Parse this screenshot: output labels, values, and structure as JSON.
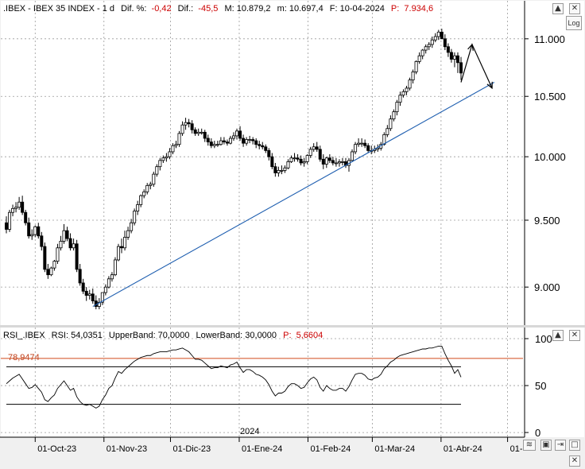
{
  "header": {
    "symbol": ".IBEX - IBEX 35 INDEX - 1 d",
    "dif_pct_label": "Dif. %:",
    "dif_pct_value": "-0,42",
    "dif_label": "Dif.:",
    "dif_value": "-45,5",
    "max_label": "M: 10.879,2",
    "min_label": "m: 10.697,4",
    "date_label": "F: 10-04-2024",
    "p_label": "P:",
    "p_value": "7.934,6"
  },
  "rsi_header": {
    "title": "RSI_.IBEX",
    "rsi_label": "RSI: 54,0351",
    "upper_label": "UpperBand: 70,0000",
    "lower_label": "LowerBand: 30,0000",
    "p_label": "P:",
    "p_value": "5,6604",
    "level_label": "78,9474"
  },
  "buttons": {
    "log": "Log",
    "up": "▲",
    "close": "✕",
    "down": "▼"
  },
  "colors": {
    "up": "#ffffff",
    "down": "#000000",
    "trend": "#1f5fb0",
    "level": "#d04a1a",
    "neg": "#cc0000"
  },
  "chart_data": [
    {
      "type": "candlestick",
      "title": ".IBEX - IBEX 35 INDEX - 1 d",
      "x": [
        "2023-09-18",
        "2023-09-19",
        "2023-09-20",
        "2023-09-21",
        "2023-09-22",
        "2023-09-25",
        "2023-09-26",
        "2023-09-27",
        "2023-09-28",
        "2023-09-29",
        "2023-10-02",
        "2023-10-03",
        "2023-10-04",
        "2023-10-05",
        "2023-10-06",
        "2023-10-09",
        "2023-10-10",
        "2023-10-11",
        "2023-10-12",
        "2023-10-13",
        "2023-10-16",
        "2023-10-17",
        "2023-10-18",
        "2023-10-19",
        "2023-10-20",
        "2023-10-23",
        "2023-10-24",
        "2023-10-25",
        "2023-10-26",
        "2023-10-27",
        "2023-10-30",
        "2023-10-31",
        "2023-11-01",
        "2023-11-02",
        "2023-11-03",
        "2023-11-06",
        "2023-11-07",
        "2023-11-08",
        "2023-11-09",
        "2023-11-10",
        "2023-11-13",
        "2023-11-14",
        "2023-11-15",
        "2023-11-16",
        "2023-11-17",
        "2023-11-20",
        "2023-11-21",
        "2023-11-22",
        "2023-11-23",
        "2023-11-24",
        "2023-11-27",
        "2023-11-28",
        "2023-11-29",
        "2023-11-30",
        "2023-12-01",
        "2023-12-04",
        "2023-12-05",
        "2023-12-06",
        "2023-12-07",
        "2023-12-08",
        "2023-12-11",
        "2023-12-12",
        "2023-12-13",
        "2023-12-14",
        "2023-12-15",
        "2023-12-18",
        "2023-12-19",
        "2023-12-20",
        "2023-12-21",
        "2023-12-22",
        "2023-12-27",
        "2023-12-28",
        "2023-12-29",
        "2024-01-02",
        "2024-01-03",
        "2024-01-04",
        "2024-01-05",
        "2024-01-08",
        "2024-01-09",
        "2024-01-10",
        "2024-01-11",
        "2024-01-12",
        "2024-01-15",
        "2024-01-16",
        "2024-01-17",
        "2024-01-18",
        "2024-01-19",
        "2024-01-22",
        "2024-01-23",
        "2024-01-24",
        "2024-01-25",
        "2024-01-26",
        "2024-01-29",
        "2024-01-30",
        "2024-01-31",
        "2024-02-01",
        "2024-02-02",
        "2024-02-05",
        "2024-02-06",
        "2024-02-07",
        "2024-02-08",
        "2024-02-09",
        "2024-02-12",
        "2024-02-13",
        "2024-02-14",
        "2024-02-15",
        "2024-02-16",
        "2024-02-19",
        "2024-02-20",
        "2024-02-21",
        "2024-02-22",
        "2024-02-23",
        "2024-02-26",
        "2024-02-27",
        "2024-02-28",
        "2024-02-29",
        "2024-03-01",
        "2024-03-04",
        "2024-03-05",
        "2024-03-06",
        "2024-03-07",
        "2024-03-08",
        "2024-03-11",
        "2024-03-12",
        "2024-03-13",
        "2024-03-14",
        "2024-03-15",
        "2024-03-18",
        "2024-03-19",
        "2024-03-20",
        "2024-03-21",
        "2024-03-22",
        "2024-03-25",
        "2024-03-26",
        "2024-03-27",
        "2024-03-28",
        "2024-04-02",
        "2024-04-03",
        "2024-04-04",
        "2024-04-05",
        "2024-04-08",
        "2024-04-09",
        "2024-04-10"
      ],
      "open": [
        9480,
        9430,
        9560,
        9590,
        9600,
        9640,
        9560,
        9480,
        9380,
        9390,
        9450,
        9380,
        9300,
        9130,
        9090,
        9140,
        9190,
        9290,
        9340,
        9420,
        9360,
        9290,
        9320,
        9130,
        9030,
        8970,
        8940,
        8950,
        8900,
        8860,
        8890,
        8960,
        9000,
        9060,
        9090,
        9200,
        9300,
        9290,
        9370,
        9420,
        9480,
        9570,
        9620,
        9690,
        9720,
        9770,
        9780,
        9860,
        9920,
        9970,
        9990,
        10000,
        10040,
        10090,
        10100,
        10190,
        10260,
        10280,
        10270,
        10220,
        10190,
        10200,
        10200,
        10150,
        10120,
        10090,
        10100,
        10100,
        10130,
        10120,
        10110,
        10150,
        10170,
        10210,
        10150,
        10110,
        10140,
        10140,
        10130,
        10100,
        10090,
        10080,
        10050,
        10000,
        9920,
        9870,
        9890,
        9890,
        9910,
        9960,
        9990,
        9990,
        9980,
        9950,
        9960,
        10010,
        10060,
        10080,
        10060,
        9980,
        9940,
        9990,
        9970,
        9950,
        9950,
        9960,
        9960,
        9930,
        9970,
        10040,
        10100,
        10110,
        10110,
        10090,
        10050,
        10050,
        10060,
        10070,
        10100,
        10180,
        10230,
        10310,
        10370,
        10450,
        10510,
        10540,
        10570,
        10640,
        10710,
        10800,
        10850,
        10900,
        10930,
        10950,
        10990,
        11020,
        11060,
        11000,
        10930,
        10880,
        10820,
        10850,
        10790
      ],
      "high": [
        9530,
        9580,
        9620,
        9640,
        9680,
        9690,
        9580,
        9520,
        9430,
        9460,
        9480,
        9410,
        9330,
        9170,
        9150,
        9200,
        9320,
        9380,
        9470,
        9450,
        9400,
        9360,
        9350,
        9170,
        9060,
        9000,
        8980,
        8990,
        8940,
        8920,
        8960,
        9020,
        9080,
        9110,
        9220,
        9320,
        9360,
        9420,
        9450,
        9510,
        9590,
        9650,
        9700,
        9740,
        9790,
        9800,
        9880,
        9940,
        9990,
        10010,
        10030,
        10070,
        10110,
        10130,
        10210,
        10290,
        10320,
        10310,
        10300,
        10240,
        10230,
        10230,
        10220,
        10180,
        10150,
        10130,
        10130,
        10160,
        10160,
        10140,
        10170,
        10200,
        10230,
        10250,
        10180,
        10160,
        10170,
        10160,
        10150,
        10130,
        10120,
        10100,
        10070,
        10030,
        9950,
        9920,
        9930,
        9930,
        9980,
        10010,
        10030,
        10020,
        10010,
        9990,
        10020,
        10080,
        10110,
        10120,
        10090,
        10020,
        10000,
        10020,
        10000,
        9990,
        9980,
        9990,
        9990,
        9990,
        10060,
        10120,
        10150,
        10150,
        10140,
        10110,
        10090,
        10090,
        10100,
        10120,
        10200,
        10260,
        10340,
        10390,
        10470,
        10540,
        10560,
        10590,
        10660,
        10730,
        10810,
        10880,
        10910,
        10950,
        10970,
        11020,
        11050,
        11080,
        11090,
        11040,
        10960,
        10910,
        10880,
        10880,
        10840
      ],
      "low": [
        9400,
        9410,
        9530,
        9560,
        9580,
        9540,
        9460,
        9360,
        9350,
        9370,
        9360,
        9270,
        9110,
        9060,
        9080,
        9120,
        9170,
        9270,
        9320,
        9340,
        9270,
        9270,
        9110,
        9010,
        8950,
        8900,
        8910,
        8880,
        8840,
        8840,
        8870,
        8940,
        8990,
        9040,
        9080,
        9190,
        9250,
        9270,
        9350,
        9400,
        9460,
        9540,
        9600,
        9670,
        9700,
        9740,
        9760,
        9840,
        9890,
        9950,
        9960,
        9980,
        10020,
        10070,
        10080,
        10170,
        10220,
        10240,
        10190,
        10170,
        10170,
        10180,
        10120,
        10090,
        10070,
        10070,
        10080,
        10090,
        10100,
        10090,
        10100,
        10130,
        10140,
        10130,
        10080,
        10090,
        10110,
        10100,
        10070,
        10060,
        10060,
        10030,
        9970,
        9900,
        9840,
        9840,
        9860,
        9870,
        9900,
        9950,
        9960,
        9960,
        9930,
        9920,
        9940,
        9990,
        10040,
        10040,
        9960,
        9900,
        9910,
        9950,
        9930,
        9920,
        9920,
        9930,
        9910,
        9880,
        9960,
        10020,
        10080,
        10080,
        10070,
        10030,
        10020,
        10030,
        10040,
        10050,
        10090,
        10160,
        10210,
        10290,
        10340,
        10420,
        10490,
        10510,
        10550,
        10610,
        10690,
        10780,
        10820,
        10870,
        10900,
        10920,
        10970,
        10990,
        11000,
        10900,
        10840,
        10790,
        10750,
        10700,
        10640
      ],
      "close": [
        9430,
        9560,
        9590,
        9600,
        9640,
        9560,
        9480,
        9380,
        9390,
        9450,
        9380,
        9300,
        9130,
        9090,
        9140,
        9190,
        9290,
        9340,
        9420,
        9360,
        9290,
        9320,
        9130,
        9030,
        8970,
        8940,
        8950,
        8900,
        8860,
        8890,
        8960,
        9000,
        9060,
        9090,
        9200,
        9300,
        9290,
        9370,
        9420,
        9480,
        9570,
        9620,
        9690,
        9720,
        9770,
        9780,
        9860,
        9920,
        9970,
        9990,
        10000,
        10040,
        10090,
        10100,
        10190,
        10260,
        10280,
        10270,
        10220,
        10190,
        10200,
        10200,
        10150,
        10120,
        10090,
        10100,
        10100,
        10130,
        10120,
        10110,
        10150,
        10170,
        10210,
        10150,
        10110,
        10140,
        10140,
        10130,
        10100,
        10090,
        10080,
        10050,
        10000,
        9920,
        9870,
        9890,
        9890,
        9910,
        9960,
        9990,
        9990,
        9980,
        9950,
        9960,
        10010,
        10060,
        10080,
        10060,
        9980,
        9940,
        9990,
        9970,
        9950,
        9950,
        9960,
        9960,
        9930,
        9970,
        10040,
        10100,
        10110,
        10110,
        10090,
        10050,
        10050,
        10060,
        10070,
        10100,
        10180,
        10230,
        10310,
        10370,
        10450,
        10510,
        10540,
        10570,
        10640,
        10710,
        10800,
        10850,
        10900,
        10930,
        10950,
        10990,
        11020,
        11060,
        11000,
        10930,
        10880,
        10820,
        10850,
        10790,
        10700
      ],
      "y_ticks": [
        "11.000",
        "10.500",
        "10.000",
        "9.500",
        "9.000"
      ],
      "ylim": [
        8750,
        11220
      ],
      "scale": "log",
      "trendline": {
        "from": [
          "2023-10-27",
          8860
        ],
        "to": [
          "2024-04-25",
          10620
        ]
      },
      "arrow_path": [
        [
          "2024-04-10",
          10620
        ],
        [
          "2024-04-15",
          10950
        ],
        [
          "2024-04-24",
          10570
        ]
      ]
    },
    {
      "type": "line",
      "title": "RSI_.IBEX",
      "y_ticks": [
        "100",
        "50",
        "0"
      ],
      "ylim": [
        -5,
        100
      ],
      "bands": [
        70,
        30
      ],
      "level": 78.9474,
      "rsi": [
        52,
        55,
        58,
        60,
        62,
        57,
        52,
        47,
        48,
        51,
        47,
        43,
        35,
        33,
        37,
        40,
        47,
        51,
        55,
        50,
        45,
        47,
        38,
        33,
        30,
        29,
        30,
        28,
        26,
        28,
        35,
        40,
        47,
        50,
        58,
        65,
        63,
        67,
        70,
        73,
        76,
        78,
        80,
        81,
        82,
        82,
        84,
        85,
        86,
        86,
        86,
        87,
        88,
        88,
        89,
        90,
        88,
        86,
        82,
        78,
        78,
        77,
        74,
        71,
        68,
        69,
        69,
        71,
        70,
        69,
        72,
        73,
        75,
        69,
        64,
        67,
        67,
        65,
        62,
        61,
        59,
        56,
        51,
        44,
        39,
        42,
        42,
        44,
        49,
        52,
        52,
        50,
        47,
        48,
        53,
        57,
        59,
        56,
        48,
        44,
        50,
        47,
        45,
        45,
        47,
        47,
        44,
        49,
        56,
        62,
        63,
        63,
        61,
        57,
        56,
        58,
        59,
        62,
        68,
        71,
        75,
        77,
        80,
        82,
        83,
        84,
        85,
        86,
        87,
        88,
        89,
        89,
        90,
        90,
        91,
        92,
        92,
        84,
        77,
        71,
        63,
        67,
        59
      ],
      "x_labels": [
        "01-Oct-23",
        "01-Nov-23",
        "01-Dic-23",
        "01-Ene-24",
        "01-Feb-24",
        "01-Mar-24",
        "01-Abr-24",
        "01-"
      ],
      "year_label": "2024"
    }
  ]
}
